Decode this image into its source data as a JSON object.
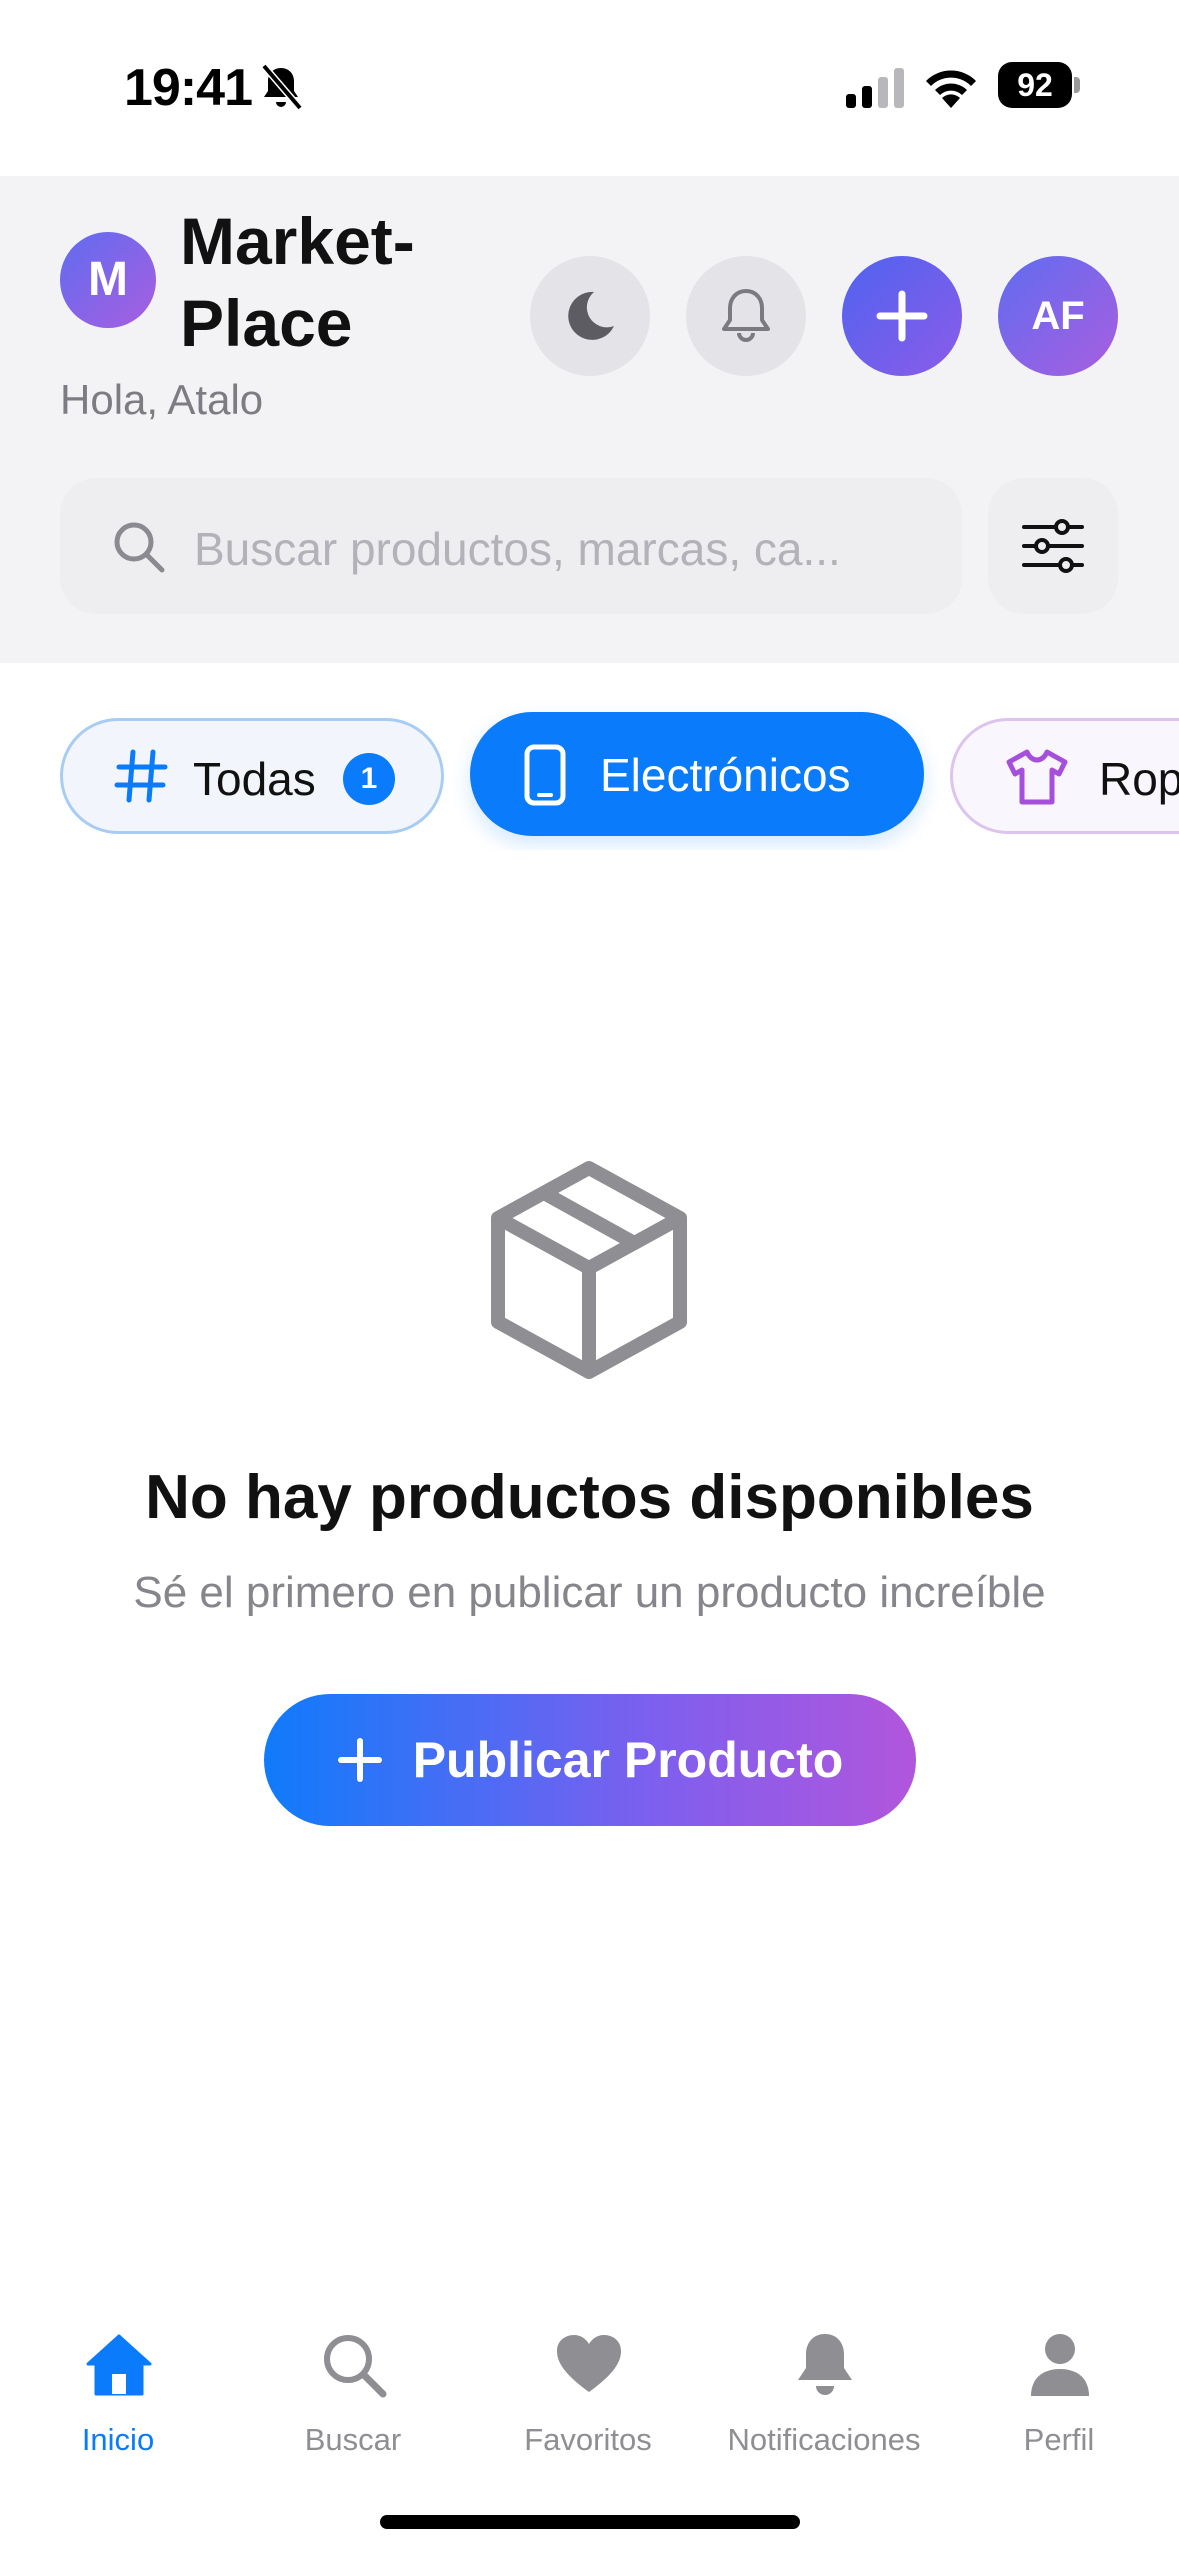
{
  "status_bar": {
    "time": "19:41",
    "battery_level": "92",
    "silent_icon": "bell-slash-icon",
    "signal_icon": "cellular-signal-icon",
    "wifi_icon": "wifi-icon"
  },
  "header": {
    "logo_letter": "M",
    "app_title": "Market-\nPlace",
    "greeting": "Hola, Atalo",
    "theme_icon": "moon-icon",
    "bell_icon": "bell-icon",
    "add_icon": "plus-icon",
    "profile_initials": "AF"
  },
  "search": {
    "placeholder": "Buscar productos, marcas, ca...",
    "filter_icon": "sliders-icon"
  },
  "categories": [
    {
      "label": "Todas",
      "icon": "hashtag-icon",
      "badge": "1",
      "active": false
    },
    {
      "label": "Electrónicos",
      "icon": "phone-icon",
      "active": true
    },
    {
      "label": "Ropa",
      "icon": "tshirt-icon",
      "active": false
    }
  ],
  "empty_state": {
    "icon": "box-icon",
    "title": "No hay productos disponibles",
    "subtitle": "Sé el primero en publicar un producto increíble",
    "button_label": "Publicar Producto"
  },
  "tab_bar": {
    "items": [
      {
        "label": "Inicio",
        "icon": "home-icon",
        "active": true
      },
      {
        "label": "Buscar",
        "icon": "search-icon",
        "active": false
      },
      {
        "label": "Favoritos",
        "icon": "heart-icon",
        "active": false
      },
      {
        "label": "Notificaciones",
        "icon": "bell-icon",
        "active": false
      },
      {
        "label": "Perfil",
        "icon": "person-icon",
        "active": false
      }
    ]
  },
  "colors": {
    "accent": "#0a7bfa",
    "gradient_start": "#0f7bfb",
    "gradient_end": "#b156dc",
    "inactive": "#8e8e93"
  }
}
